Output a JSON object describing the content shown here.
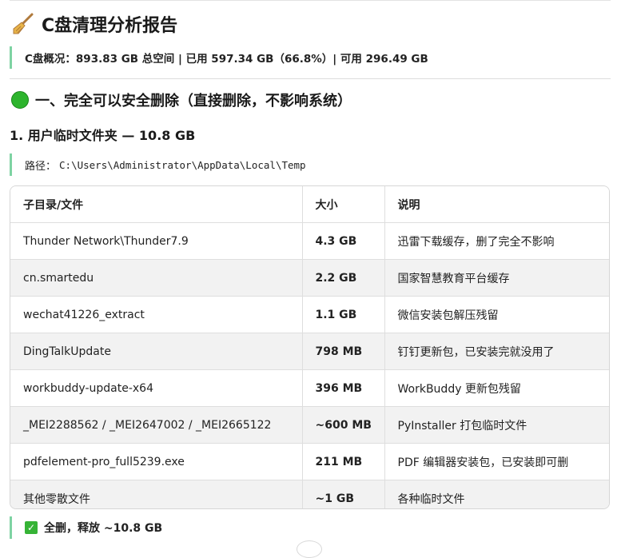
{
  "report": {
    "title": "C盘清理分析报告",
    "title_icon": "broom-icon",
    "overview": "C盘概况：893.83 GB 总空间 | 已用 597.34 GB（66.8%）| 可用 296.49 GB"
  },
  "section1": {
    "icon": "green-circle-icon",
    "heading": "一、完全可以安全删除（直接删除，不影响系统）",
    "item1": {
      "heading": "1. 用户临时文件夹 — 10.8 GB",
      "path_label": "路径：",
      "path_value": "C:\\Users\\Administrator\\AppData\\Local\\Temp",
      "table": {
        "headers": [
          "子目录/文件",
          "大小",
          "说明"
        ],
        "rows": [
          [
            "Thunder Network\\Thunder7.9",
            "4.3 GB",
            "迅雷下载缓存，删了完全不影响"
          ],
          [
            "cn.smartedu",
            "2.2 GB",
            "国家智慧教育平台缓存"
          ],
          [
            "wechat41226_extract",
            "1.1 GB",
            "微信安装包解压残留"
          ],
          [
            "DingTalkUpdate",
            "798 MB",
            "钉钉更新包，已安装完就没用了"
          ],
          [
            "workbuddy-update-x64",
            "396 MB",
            "WorkBuddy 更新包残留"
          ],
          [
            "_MEI2288562 / _MEI2647002 / _MEI2665122",
            "~600 MB",
            "PyInstaller 打包临时文件"
          ],
          [
            "pdfelement-pro_full5239.exe",
            "211 MB",
            "PDF 编辑器安装包，已安装即可删"
          ],
          [
            "其他零散文件",
            "~1 GB",
            "各种临时文件"
          ]
        ]
      },
      "result_icon": "check-mark-icon",
      "result": "全删，释放 ~10.8 GB"
    }
  },
  "colors": {
    "accent_bar": "#7ed3a3",
    "green_dot": "#2db42d",
    "check_bg": "#36b336",
    "stripe": "#f2f2f2"
  }
}
